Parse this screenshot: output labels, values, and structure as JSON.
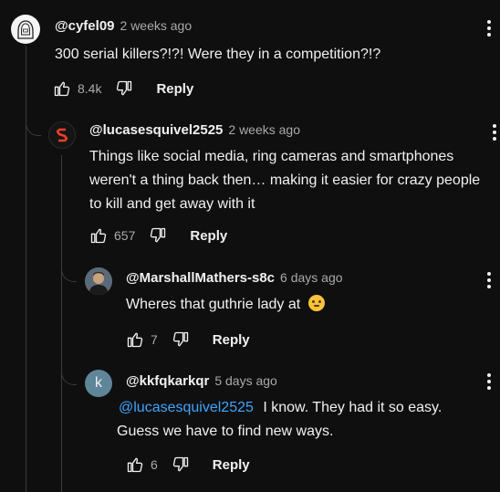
{
  "comments": [
    {
      "handle": "@cyfel09",
      "time": "2 weeks ago",
      "text": "300 serial killers?!?! Were they in a competition?!?",
      "likes": "8.4k",
      "reply_label": "Reply",
      "avatar_icon": "hooded-figure-avatar"
    },
    {
      "handle": "@lucasesquivel2525",
      "time": "2 weeks ago",
      "text": "Things like social media, ring cameras and smartphones weren't a thing back then… making it easier for crazy people to kill and get away with it",
      "likes": "657",
      "reply_label": "Reply",
      "avatar_icon": "s-logo-avatar"
    },
    {
      "handle": "@MarshallMathers-s8c",
      "time": "6 days ago",
      "text": "Wheres that guthrie lady at",
      "emoji": "thinking-face-emoji",
      "likes": "7",
      "reply_label": "Reply",
      "avatar_icon": "photo-avatar"
    },
    {
      "handle": "@kkfqkarkqr",
      "time": "5 days ago",
      "mention": "@lucasesquivel2525",
      "text": "I know. They had it so easy. Guess we have to find new ways.",
      "likes": "6",
      "reply_label": "Reply",
      "avatar_letter": "k",
      "avatar_color": "#5f8598"
    }
  ]
}
